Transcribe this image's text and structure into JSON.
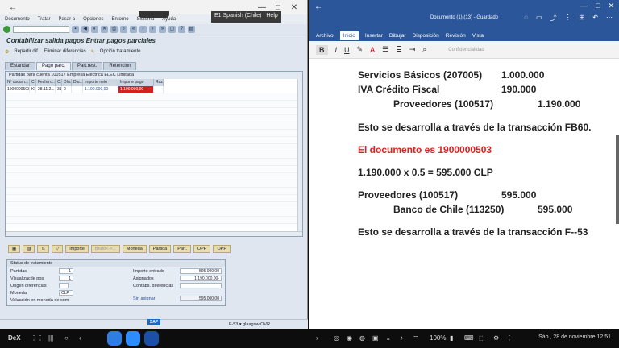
{
  "sap": {
    "menu": [
      "Documento",
      "Tratar",
      "Pasar a",
      "Opciones",
      "Entorno",
      "Sistema",
      "Ayuda"
    ],
    "connection_tag": "E1 Spanish (Chile)",
    "help_tag": "Help",
    "screen_title": "Contabilizar salida pagos Entrar pagos parciales",
    "app_toolbar": [
      "Repartir dif.",
      "Eliminar diferencias",
      "Opción tratamiento"
    ],
    "tabs": [
      "Estándar",
      "Pago parc.",
      "Part.rest.",
      "Retención"
    ],
    "grid_caption": "Partidas para cuenta 100517 Empresa Eléctrica ELEC Limitada",
    "grid_headers": [
      "Nº docum...",
      "C...",
      "Fecha d...",
      "C...",
      "Día...",
      "Diu...",
      "Importe neto",
      "Importe pago",
      "Raz"
    ],
    "grid_row": [
      "1900000503",
      "KR",
      "28.11.2...",
      "31",
      "0",
      "",
      "1.190.000,00-",
      "1.190.000,00-",
      ""
    ],
    "buttons": [
      "Importe",
      "Bruto<->...",
      "Moneda",
      "Partida",
      "Part.",
      "OPP",
      "OPP"
    ],
    "status_title": "Status de tratamiento",
    "status": {
      "partidas_label": "Partidas",
      "partidas_value": "1",
      "visual_label": "Visualizacde pos",
      "visual_value": "1",
      "origen_label": "Origen diferencias",
      "moneda_label": "Moneda",
      "moneda_value": "CLP",
      "valuacion_label": "Valuación en moneda de com",
      "importe_entrado_label": "Importe entrado",
      "importe_entrado_value": "595.000,00",
      "asignados_label": "Asignados",
      "asignados_value": "1.190.000,00-",
      "contabs_label": "Contabs. diferencias",
      "sin_asignar_label": "Sin asignar",
      "sin_asignar_value": "595.000,00"
    },
    "status_bar": "F-53  ▾  glaagow  OVR"
  },
  "word": {
    "title": "Documento (1) (13) - Guardado",
    "ribbon_tabs": [
      "Archivo",
      "Inicio",
      "Insertar",
      "Dibujar",
      "Disposición",
      "Revisión",
      "Vista"
    ],
    "ribbon_conf": "Confidencialidad",
    "lines": {
      "l1_label": "Servicios Básicos (207005)",
      "l1_value": "1.000.000",
      "l2_label": "IVA Crédito Fiscal",
      "l2_value": "190.000",
      "l3_label": "Proveedores (100517)",
      "l3_value": "1.190.000",
      "l4": "Esto se desarrolla a través de la transacción FB60.",
      "l5": "El documento es 1900000503",
      "l6": "1.190.000 x 0.5 = 595.000 CLP",
      "l7_label": "Proveedores (100517)",
      "l7_value": "595.000",
      "l8_label": "Banco de Chile (113250)",
      "l8_value": "595.000",
      "l9": "Esto se desarrolla a través de la transacción F--53"
    }
  },
  "taskbar": {
    "dex": "DeX",
    "battery": "100%",
    "clock": "Sáb., 28 de noviembre 12:51"
  },
  "colors": {
    "word_blue": "#2b579a",
    "red_text": "#e02020",
    "sap_bg": "#dfe6ef"
  }
}
